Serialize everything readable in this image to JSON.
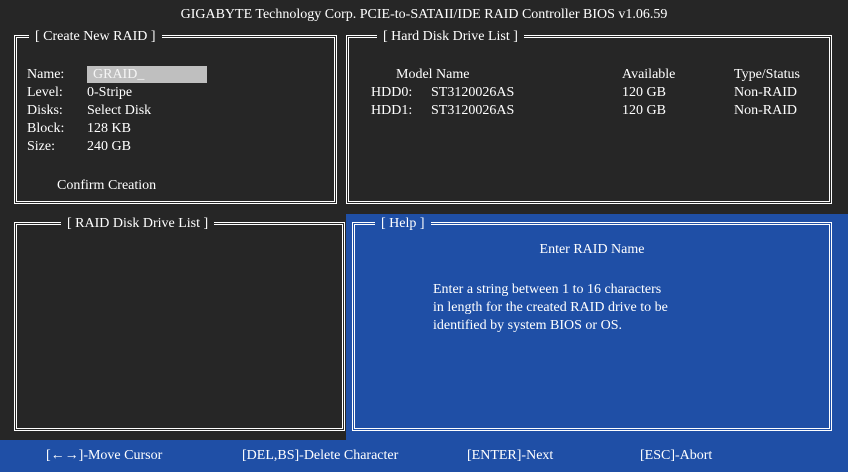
{
  "title": "GIGABYTE Technology Corp. PCIE-to-SATAII/IDE RAID Controller BIOS v1.06.59",
  "create_panel": {
    "title": "[ Create New RAID ]",
    "fields": [
      {
        "label": "Name:",
        "value": "GRAID_"
      },
      {
        "label": "Level:",
        "value": "0-Stripe"
      },
      {
        "label": "Disks:",
        "value": "Select Disk"
      },
      {
        "label": "Block:",
        "value": "128 KB"
      },
      {
        "label": "Size:",
        "value": "240 GB"
      }
    ],
    "confirm_label": "Confirm Creation"
  },
  "hdd_panel": {
    "title": "[ Hard Disk Drive List ]",
    "headers": {
      "model": "Model Name",
      "available": "Available",
      "type": "Type/Status"
    },
    "rows": [
      {
        "id": "HDD0:",
        "model": "ST3120026AS",
        "available": "120 GB",
        "type": "Non-RAID"
      },
      {
        "id": "HDD1:",
        "model": "ST3120026AS",
        "available": "120 GB",
        "type": "Non-RAID"
      }
    ]
  },
  "raid_panel": {
    "title": "[ RAID Disk Drive List ]"
  },
  "help_panel": {
    "title": "[ Help ]",
    "heading": "Enter RAID Name",
    "lines": [
      "Enter a string between 1 to 16 characters",
      "in length for the created RAID drive to be",
      "identified by system BIOS or OS."
    ]
  },
  "footer": {
    "move": "[←→]-Move Cursor",
    "delete": "[DEL,BS]-Delete Character",
    "next": "[ENTER]-Next",
    "abort": "[ESC]-Abort"
  },
  "colors": {
    "background": "#262626",
    "help_blue": "#1f4fa6",
    "input_gray": "#bfbfbf"
  }
}
